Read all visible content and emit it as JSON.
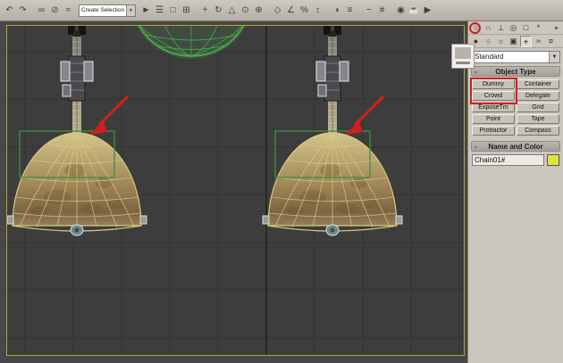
{
  "colors": {
    "viewport_bg": "#3d3d3d",
    "grid_line": "#343434",
    "grid_major": "#1f1f1f",
    "viewport_border": "#b2a52a",
    "panel_bg": "#cbc7bf",
    "toolbar_bg": "#b3afa7",
    "button_bg": "#c6c2ba",
    "rollout_header_bg": "#b9b5ad",
    "annotation_red": "#cf1f1f",
    "selection_green": "#3f8f3f",
    "sphere_green": "#49b449",
    "dome_wire": "#d8cb7e",
    "name_swatch_yellow": "#e6e23c"
  },
  "glyphs": {
    "down_arrow": "▼",
    "minus": "-"
  },
  "toolbar": {
    "selection_set_value": "Create Selection Set",
    "icons": [
      {
        "name": "undo-icon",
        "glyph": "↶"
      },
      {
        "name": "redo-icon",
        "glyph": "↷"
      },
      {
        "name": "select-and-link-icon",
        "glyph": "∞"
      },
      {
        "name": "unlink-selection-icon",
        "glyph": "⊘"
      },
      {
        "name": "bind-to-space-warp-icon",
        "glyph": "≈"
      },
      {
        "name": "select-object-icon",
        "glyph": "►"
      },
      {
        "name": "select-by-name-icon",
        "glyph": "☰"
      },
      {
        "name": "rectangular-selection-icon",
        "glyph": "□"
      },
      {
        "name": "window-crossing-icon",
        "glyph": "⊞"
      },
      {
        "name": "select-and-move-icon",
        "glyph": "+"
      },
      {
        "name": "select-and-rotate-icon",
        "glyph": "↻"
      },
      {
        "name": "select-and-scale-icon",
        "glyph": "△"
      },
      {
        "name": "use-center-icon",
        "glyph": "⊙"
      },
      {
        "name": "select-and-manipulate-icon",
        "glyph": "⊕"
      },
      {
        "name": "snaps-toggle-icon",
        "glyph": "◇"
      },
      {
        "name": "angle-snap-icon",
        "glyph": "∠"
      },
      {
        "name": "percent-snap-icon",
        "glyph": "%"
      },
      {
        "name": "spinner-snap-icon",
        "glyph": "↕"
      },
      {
        "name": "mirror-icon",
        "glyph": "◑"
      },
      {
        "name": "align-icon",
        "glyph": "≡"
      },
      {
        "name": "curve-editor-icon",
        "glyph": "~"
      },
      {
        "name": "schematic-view-icon",
        "glyph": "#"
      },
      {
        "name": "material-editor-icon",
        "glyph": "◉"
      },
      {
        "name": "render-setup-icon",
        "glyph": "☕"
      },
      {
        "name": "render-production-icon",
        "glyph": "▶"
      }
    ]
  },
  "command_panel": {
    "panel_config_glyph": "►",
    "tabs": [
      {
        "name": "create-tab",
        "glyph": "☆"
      },
      {
        "name": "modify-tab",
        "glyph": "∩"
      },
      {
        "name": "hierarchy-tab",
        "glyph": "⊥"
      },
      {
        "name": "motion-tab",
        "glyph": "◎"
      },
      {
        "name": "display-tab",
        "glyph": "□"
      },
      {
        "name": "utilities-tab",
        "glyph": "*"
      }
    ],
    "categories": [
      {
        "name": "geometry-category",
        "glyph": "●"
      },
      {
        "name": "shapes-category",
        "glyph": "○"
      },
      {
        "name": "lights-category",
        "glyph": "☼"
      },
      {
        "name": "cameras-category",
        "glyph": "▣"
      },
      {
        "name": "helpers-category",
        "glyph": "⌖"
      },
      {
        "name": "space-warps-category",
        "glyph": "≈"
      },
      {
        "name": "systems-category",
        "glyph": "¤"
      }
    ],
    "subcategory_dropdown_value": "Standard",
    "rollouts": {
      "object_type": {
        "title": "Object Type",
        "buttons": [
          "Dummy",
          "Container",
          "Crowd",
          "Delegate",
          "ExposeTm",
          "Grid",
          "Point",
          "Tape",
          "Protractor",
          "Compass"
        ]
      },
      "name_and_color": {
        "title": "Name and Color",
        "name_value": "Chain01#"
      }
    }
  }
}
